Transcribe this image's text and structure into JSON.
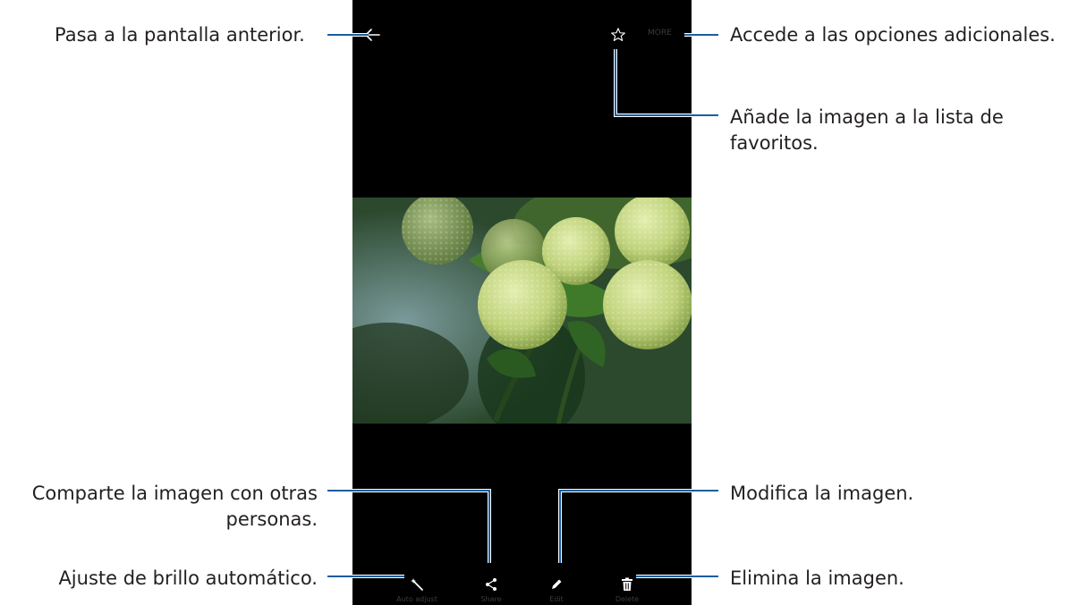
{
  "annotations": {
    "back": "Pasa a la pantalla anterior.",
    "more": "Accede a las opciones adicionales.",
    "favorite_line1": "Añade la imagen a la lista de",
    "favorite_line2": "favoritos.",
    "share_line1": "Comparte la imagen con otras",
    "share_line2": "personas.",
    "edit": "Modifica la imagen.",
    "auto_adjust": "Ajuste de brillo automático.",
    "delete": "Elimina la imagen."
  },
  "toolbar": {
    "more_label": "MORE"
  },
  "bottom_bar": {
    "auto_adjust": "Auto adjust",
    "share": "Share",
    "edit": "Edit",
    "delete": "Delete"
  },
  "colors": {
    "callout_line": "#1b5e9f",
    "screen_bg": "#000000"
  },
  "icons": [
    "back-arrow-icon",
    "star-icon",
    "magic-wand-icon",
    "share-icon",
    "pencil-icon",
    "trash-icon"
  ]
}
